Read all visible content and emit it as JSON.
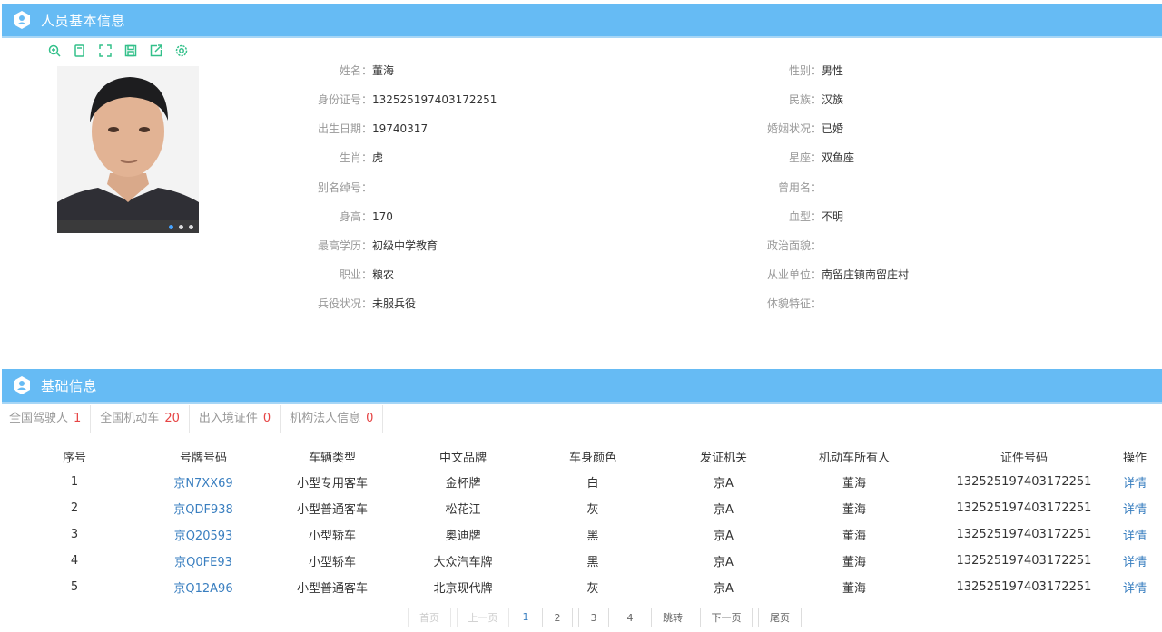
{
  "header1": {
    "title": "人员基本信息"
  },
  "toolbar": {
    "icons": [
      "zoom-icon",
      "copy-icon",
      "fullscreen-icon",
      "save-icon",
      "export-icon",
      "settings-icon"
    ]
  },
  "person": {
    "left": [
      {
        "label": "姓名：",
        "value": "董海"
      },
      {
        "label": "身份证号：",
        "value": "132525197403172251"
      },
      {
        "label": "出生日期：",
        "value": "19740317"
      },
      {
        "label": "生肖：",
        "value": "虎"
      },
      {
        "label": "别名绰号：",
        "value": ""
      },
      {
        "label": "身高：",
        "value": "170"
      },
      {
        "label": "最高学历：",
        "value": "初级中学教育"
      },
      {
        "label": "职业：",
        "value": "粮农"
      },
      {
        "label": "兵役状况：",
        "value": "未服兵役"
      }
    ],
    "right": [
      {
        "label": "性别：",
        "value": "男性"
      },
      {
        "label": "民族：",
        "value": "汉族"
      },
      {
        "label": "婚姻状况：",
        "value": "已婚"
      },
      {
        "label": "星座：",
        "value": "双鱼座"
      },
      {
        "label": "曾用名：",
        "value": ""
      },
      {
        "label": "血型：",
        "value": "不明"
      },
      {
        "label": "政治面貌：",
        "value": ""
      },
      {
        "label": "从业单位：",
        "value": "南留庄镇南留庄村"
      },
      {
        "label": "体貌特征：",
        "value": ""
      }
    ]
  },
  "header2": {
    "title": "基础信息"
  },
  "tabs": [
    {
      "label": "全国驾驶人",
      "count": "1"
    },
    {
      "label": "全国机动车",
      "count": "20"
    },
    {
      "label": "出入境证件",
      "count": "0"
    },
    {
      "label": "机构法人信息",
      "count": "0"
    }
  ],
  "table": {
    "columns": [
      "序号",
      "号牌号码",
      "车辆类型",
      "中文品牌",
      "车身颜色",
      "发证机关",
      "机动车所有人",
      "证件号码",
      "操作"
    ],
    "rows": [
      [
        "1",
        "京N7XX69",
        "小型专用客车",
        "金杯牌",
        "白",
        "京A",
        "董海",
        "132525197403172251",
        "详情"
      ],
      [
        "2",
        "京QDF938",
        "小型普通客车",
        "松花江",
        "灰",
        "京A",
        "董海",
        "132525197403172251",
        "详情"
      ],
      [
        "3",
        "京Q20593",
        "小型轿车",
        "奥迪牌",
        "黑",
        "京A",
        "董海",
        "132525197403172251",
        "详情"
      ],
      [
        "4",
        "京Q0FE93",
        "小型轿车",
        "大众汽车牌",
        "黑",
        "京A",
        "董海",
        "132525197403172251",
        "详情"
      ],
      [
        "5",
        "京Q12A96",
        "小型普通客车",
        "北京现代牌",
        "灰",
        "京A",
        "董海",
        "132525197403172251",
        "详情"
      ]
    ]
  },
  "pager": {
    "first": "首页",
    "prev": "上一页",
    "pages": [
      "1",
      "2",
      "3",
      "4"
    ],
    "jump": "跳转",
    "next": "下一页",
    "last": "尾页"
  },
  "colors": {
    "header": "#66bbf4",
    "accent": "#3a7fc0",
    "count": "#e64545",
    "toolbar_icon": "#33c08a"
  }
}
